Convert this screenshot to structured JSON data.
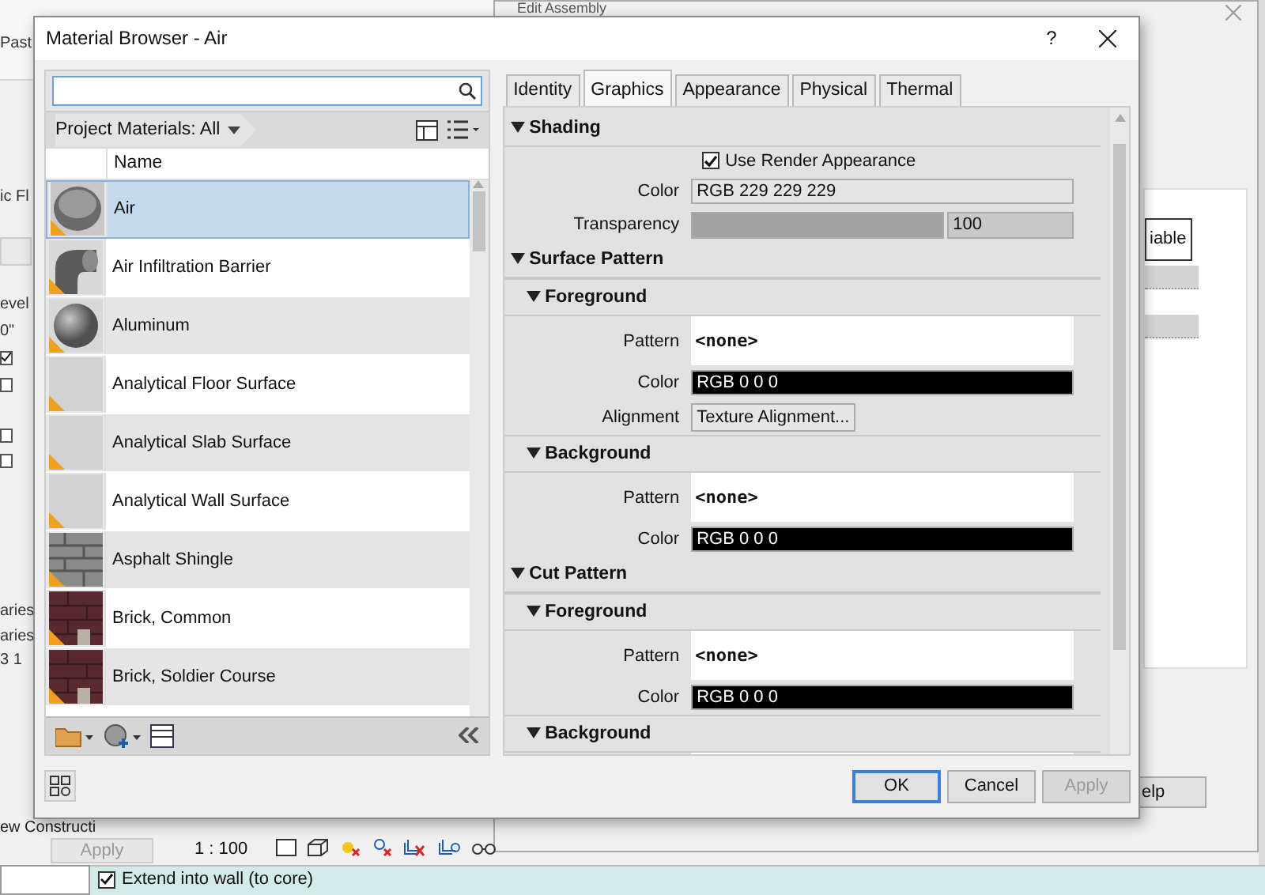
{
  "background": {
    "ribbon_fragment": "Past",
    "properties_fragments": [
      "ic Fl",
      "evel",
      "0\"",
      "aries",
      "aries",
      "3 1"
    ],
    "property_checkboxes": [
      {
        "checked": true
      },
      {
        "checked": false
      },
      {
        "checked": false
      },
      {
        "checked": false
      }
    ],
    "view_name_fragment": "ew Constructi",
    "apply_button": {
      "label": "Apply",
      "disabled": true
    },
    "scale": "1 : 100",
    "option": {
      "label": "Extend into wall (to core)",
      "checked": true
    },
    "edit_assembly": {
      "title": "Edit Assembly",
      "column_header_fragment": "iable",
      "help_button_fragment": "elp"
    }
  },
  "window": {
    "title": "Material Browser - Air",
    "help": "?"
  },
  "browser": {
    "library_filter": "Project Materials: All",
    "columns": [
      "Name"
    ],
    "materials": [
      {
        "name": "Air",
        "kind": "shell",
        "selected": true
      },
      {
        "name": "Air Infiltration Barrier",
        "kind": "pipe",
        "selected": false
      },
      {
        "name": "Aluminum",
        "kind": "sphere",
        "selected": false
      },
      {
        "name": "Analytical Floor Surface",
        "kind": "blank",
        "selected": false
      },
      {
        "name": "Analytical Slab Surface",
        "kind": "blank",
        "selected": false
      },
      {
        "name": "Analytical Wall Surface",
        "kind": "blank",
        "selected": false
      },
      {
        "name": "Asphalt Shingle",
        "kind": "masonry",
        "selected": false
      },
      {
        "name": "Brick, Common",
        "kind": "brick",
        "selected": false
      },
      {
        "name": "Brick, Soldier Course",
        "kind": "brick",
        "selected": false
      }
    ]
  },
  "tabs": [
    {
      "label": "Identity",
      "selected": false
    },
    {
      "label": "Graphics",
      "selected": true
    },
    {
      "label": "Appearance",
      "selected": false
    },
    {
      "label": "Physical",
      "selected": false
    },
    {
      "label": "Thermal",
      "selected": false
    }
  ],
  "properties": [
    {
      "kind": "section",
      "label": "Shading"
    },
    {
      "kind": "checkbox",
      "label": "Use Render Appearance",
      "checked": true
    },
    {
      "kind": "color",
      "label": "Color",
      "value": "RGB 229 229 229",
      "color": "#e5e5e5"
    },
    {
      "kind": "slider",
      "label": "Transparency",
      "level": 1,
      "reading": "100"
    },
    {
      "kind": "section",
      "label": "Surface Pattern"
    },
    {
      "kind": "subsection",
      "label": "Foreground"
    },
    {
      "kind": "pattern",
      "label": "Pattern",
      "value": "<none>"
    },
    {
      "kind": "color",
      "label": "Color",
      "value": "RGB 0 0 0",
      "color": "#000000"
    },
    {
      "kind": "button",
      "label": "Alignment",
      "value": "Texture Alignment..."
    },
    {
      "kind": "subsection",
      "label": "Background"
    },
    {
      "kind": "pattern",
      "label": "Pattern",
      "value": "<none>"
    },
    {
      "kind": "color",
      "label": "Color",
      "value": "RGB 0 0 0",
      "color": "#000000"
    },
    {
      "kind": "section",
      "label": "Cut Pattern"
    },
    {
      "kind": "subsection",
      "label": "Foreground"
    },
    {
      "kind": "pattern",
      "label": "Pattern",
      "value": "<none>"
    },
    {
      "kind": "color",
      "label": "Color",
      "value": "RGB 0 0 0",
      "color": "#000000"
    },
    {
      "kind": "subsection",
      "label": "Background"
    },
    {
      "kind": "pattern"
    }
  ],
  "buttons": [
    {
      "label": "OK",
      "default": true,
      "disabled": false
    },
    {
      "label": "Cancel",
      "default": false,
      "disabled": false
    },
    {
      "label": "Apply",
      "default": false,
      "disabled": true
    }
  ]
}
